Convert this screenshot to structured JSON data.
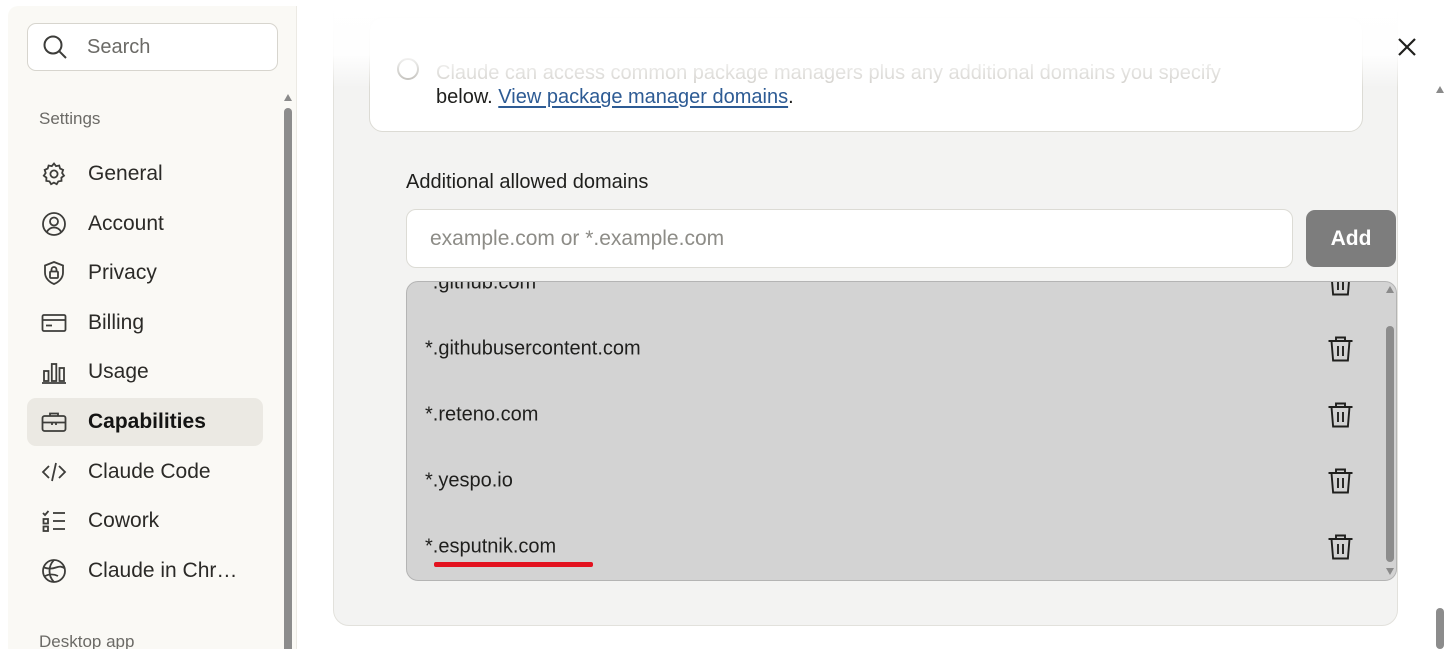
{
  "search": {
    "placeholder": "Search"
  },
  "sidebar": {
    "section_settings": "Settings",
    "section_desktop": "Desktop app",
    "items": [
      {
        "label": "General",
        "icon": "gear-icon",
        "active": false
      },
      {
        "label": "Account",
        "icon": "user-circle-icon",
        "active": false
      },
      {
        "label": "Privacy",
        "icon": "shield-lock-icon",
        "active": false
      },
      {
        "label": "Billing",
        "icon": "credit-card-icon",
        "active": false
      },
      {
        "label": "Usage",
        "icon": "bar-chart-icon",
        "active": false
      },
      {
        "label": "Capabilities",
        "icon": "briefcase-icon",
        "active": true
      },
      {
        "label": "Claude Code",
        "icon": "code-brackets-icon",
        "active": false
      },
      {
        "label": "Cowork",
        "icon": "checklist-icon",
        "active": false
      },
      {
        "label": "Claude in Chr…",
        "icon": "globe-icon",
        "active": false
      }
    ]
  },
  "main": {
    "option": {
      "description_line1": "Claude can access common package managers plus any additional domains you specify",
      "description_line2_prefix": "below.",
      "description_link": "View package manager domains",
      "description_suffix": "."
    },
    "additional_domains": {
      "label": "Additional allowed domains",
      "input_placeholder": "example.com or *.example.com",
      "input_value": "",
      "add_label": "Add",
      "domains": [
        "*.github.com",
        "*.githubusercontent.com",
        "*.reteno.com",
        "*.yespo.io",
        "*.esputnik.com"
      ]
    }
  },
  "colors": {
    "active_nav_bg": "#ebe9e3",
    "link": "#2d5b94",
    "add_button": "#7d7d7d",
    "list_bg": "#d3d3d3",
    "annotation_underline": "#e3121f"
  }
}
